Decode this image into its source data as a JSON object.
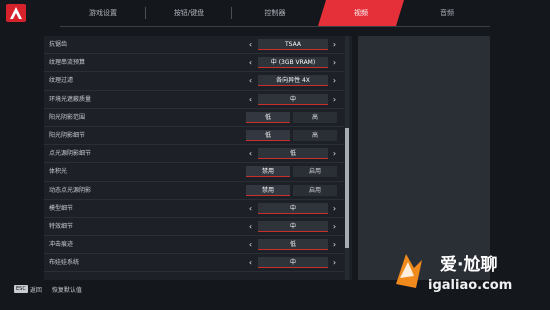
{
  "colors": {
    "accent": "#e5303a",
    "background": "#14171c",
    "panel": "#1d2127",
    "side_panel": "#2a2e35"
  },
  "tabs": [
    {
      "label": "游戏设置",
      "active": false
    },
    {
      "label": "按钮/键盘",
      "active": false
    },
    {
      "label": "控制器",
      "active": false
    },
    {
      "label": "视频",
      "active": true
    },
    {
      "label": "音频",
      "active": false
    }
  ],
  "settings": [
    {
      "label": "抗锯齿",
      "type": "cycler",
      "value": "TSAA"
    },
    {
      "label": "纹理串流预算",
      "type": "cycler",
      "value": "中 (3GB VRAM)"
    },
    {
      "label": "纹理过滤",
      "type": "cycler",
      "value": "各向异性 4X"
    },
    {
      "label": "环境光遮蔽质量",
      "type": "cycler",
      "value": "中"
    },
    {
      "label": "阳光阴影范围",
      "type": "toggle",
      "options": [
        "低",
        "高"
      ],
      "selected": 0
    },
    {
      "label": "阳光阴影细节",
      "type": "toggle",
      "options": [
        "低",
        "高"
      ],
      "selected": 0
    },
    {
      "label": "点光源阴影细节",
      "type": "cycler",
      "value": "低"
    },
    {
      "label": "体积光",
      "type": "toggle",
      "options": [
        "禁用",
        "启用"
      ],
      "selected": 0
    },
    {
      "label": "动态点光源阴影",
      "type": "toggle",
      "options": [
        "禁用",
        "启用"
      ],
      "selected": 0
    },
    {
      "label": "模型细节",
      "type": "cycler",
      "value": "中"
    },
    {
      "label": "特效细节",
      "type": "cycler",
      "value": "中"
    },
    {
      "label": "冲击痕迹",
      "type": "cycler",
      "value": "低"
    },
    {
      "label": "布娃娃系统",
      "type": "cycler",
      "value": "中"
    }
  ],
  "footer": {
    "back_key": "ESC",
    "back_label": "返回",
    "reset_label": "恢复默认值"
  },
  "watermark": {
    "title": "爱·尬聊",
    "url": "igaliao.com"
  },
  "icons": {
    "logo": "apex-logo-icon",
    "left": "chevron-left-icon",
    "right": "chevron-right-icon"
  }
}
